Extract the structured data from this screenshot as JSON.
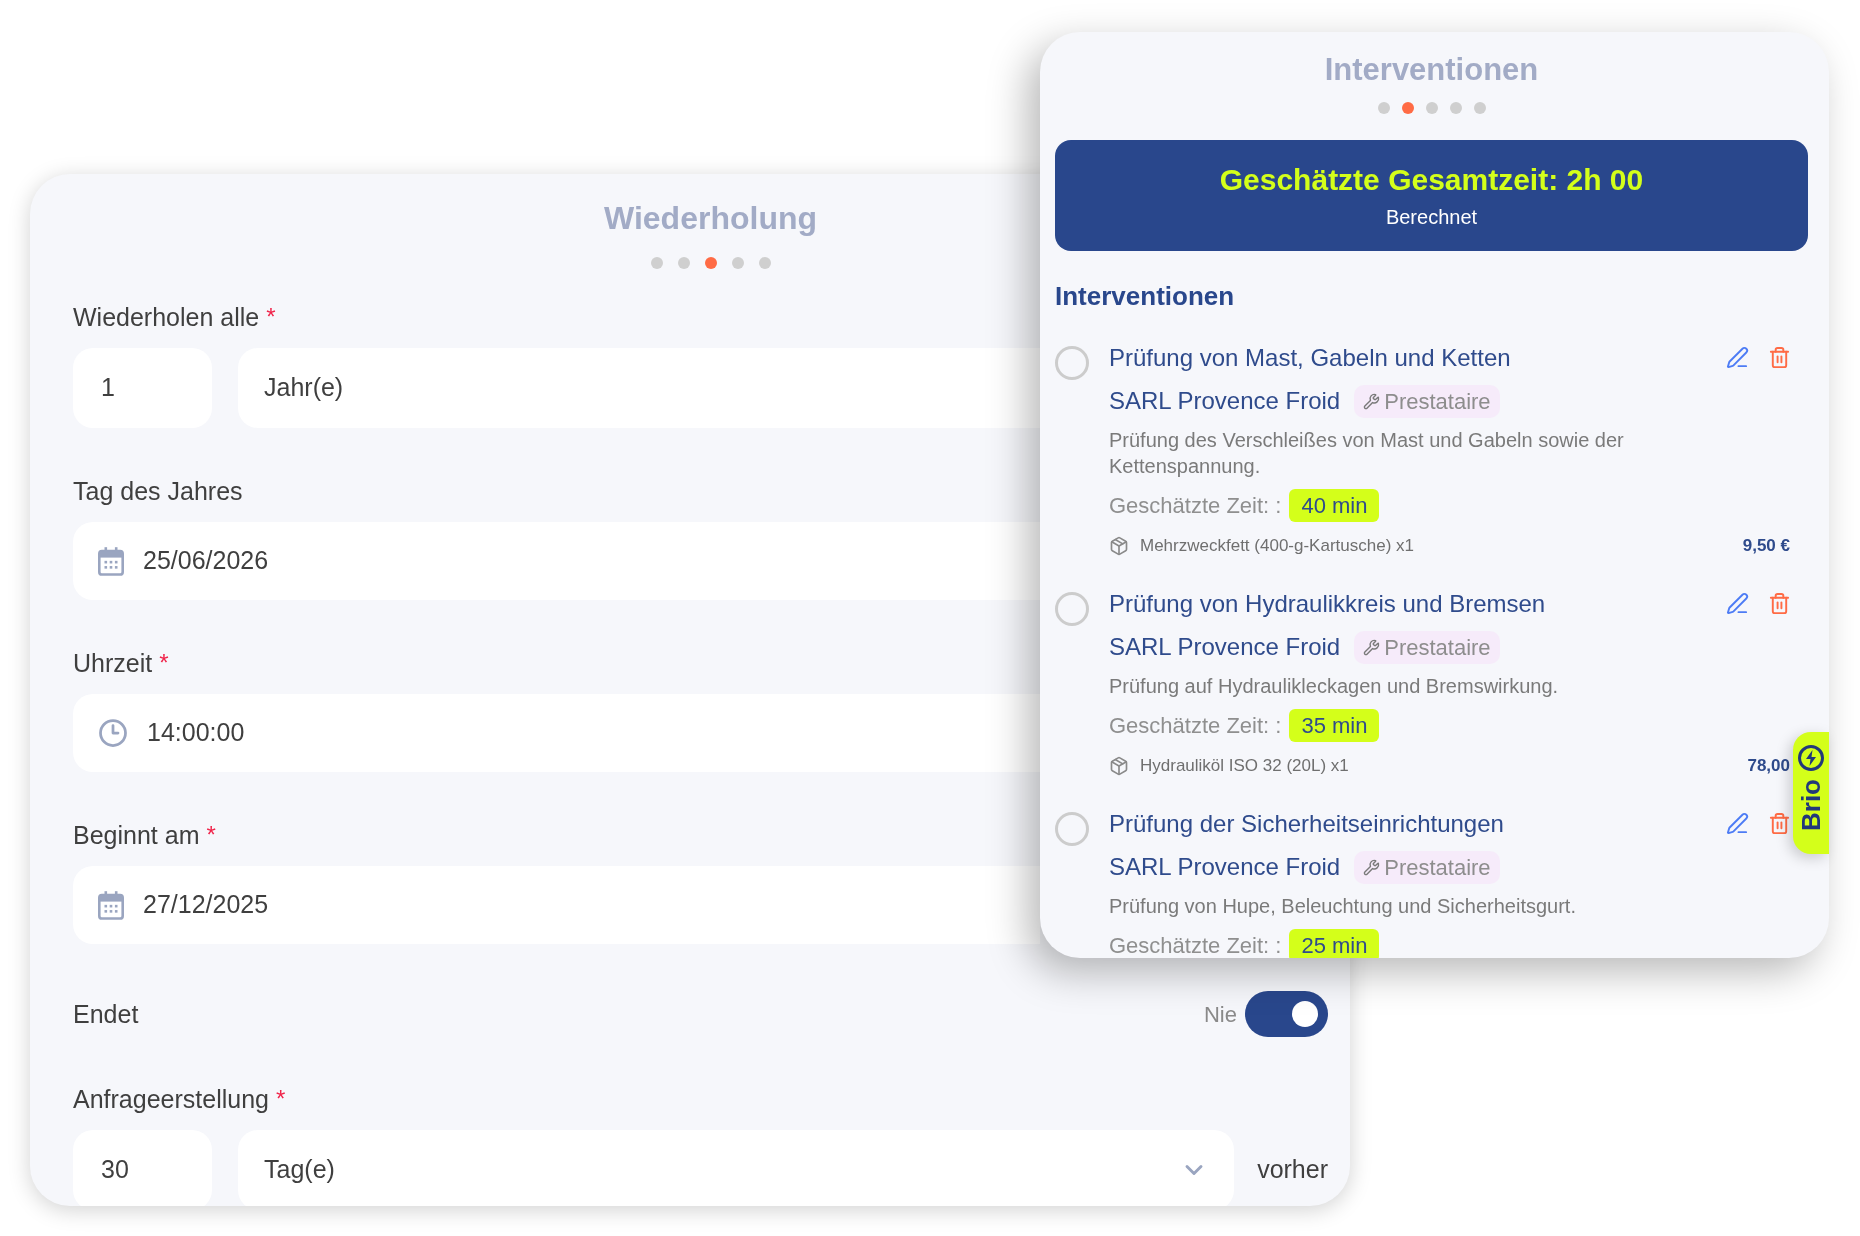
{
  "recurrence_card": {
    "title": "Wiederholung",
    "steps": [
      {
        "selected": false
      },
      {
        "selected": false
      },
      {
        "selected": true
      },
      {
        "selected": false
      },
      {
        "selected": false
      }
    ],
    "fields": [
      {
        "kind": "count_unit",
        "label": "Wiederholen alle",
        "required_mark": "*",
        "count": "1",
        "unit": "Jahr(e)",
        "dropdown": false
      },
      {
        "kind": "date",
        "label": "Tag des Jahres",
        "value": "25/06/2026"
      },
      {
        "kind": "time",
        "label": "Uhrzeit",
        "required_mark": "*",
        "value": "14:00:00"
      },
      {
        "kind": "date",
        "label": "Beginnt am",
        "required_mark": "*",
        "value": "27/12/2025"
      },
      {
        "kind": "toggle",
        "label": "Endet",
        "toggle_label": "Nie",
        "on": true
      },
      {
        "kind": "count_unit",
        "label": "Anfrageerstellung",
        "required_mark": "*",
        "count": "30",
        "unit": "Tag(e)",
        "dropdown": true,
        "suffix": "vorher"
      }
    ]
  },
  "interventions_card": {
    "title": "Interventionen",
    "steps": [
      {
        "selected": false
      },
      {
        "selected": true
      },
      {
        "selected": false
      },
      {
        "selected": false
      },
      {
        "selected": false
      }
    ],
    "estimate_banner": {
      "title": "Geschätzte Gesamtzeit: 2h 00",
      "subtitle": "Berechnet"
    },
    "section_title": "Interventionen",
    "items": [
      {
        "selected": false,
        "title": "Prüfung von Mast, Gabeln und Ketten",
        "company": "SARL Provence Froid",
        "role": "Prestataire",
        "description": "Prüfung des Verschleißes von Mast und Gabeln sowie der Kettenspannung.",
        "time_label": "Geschätzte Zeit: :",
        "time": "40 min",
        "materials": [
          {
            "name": "Mehrzweckfett (400-g-Kartusche) x1",
            "price": "9,50 €"
          }
        ]
      },
      {
        "selected": false,
        "title": "Prüfung von Hydraulikkreis und Bremsen",
        "company": "SARL Provence Froid",
        "role": "Prestataire",
        "description": "Prüfung auf Hydraulikleckagen und Bremswirkung.",
        "time_label": "Geschätzte Zeit: :",
        "time": "35 min",
        "materials": [
          {
            "name": "Hydrauliköl ISO 32 (20L) x1",
            "price": "78,00"
          }
        ]
      },
      {
        "selected": false,
        "title": "Prüfung der Sicherheitseinrichtungen",
        "company": "SARL Provence Froid",
        "role": "Prestataire",
        "description": "Prüfung von Hupe, Beleuchtung und Sicherheitsgurt.",
        "time_label": "Geschätzte Zeit: :",
        "time": "25 min"
      }
    ]
  },
  "assistant_tab": {
    "label": "Brio"
  }
}
